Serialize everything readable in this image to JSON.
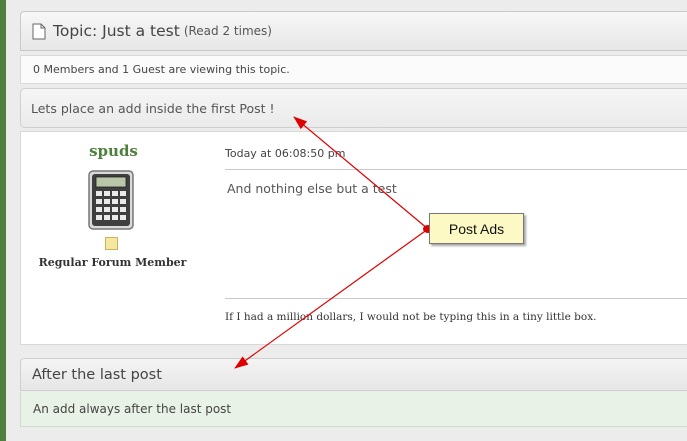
{
  "topic": {
    "title": "Topic: Just a test",
    "reads": "(Read 2 times)",
    "icon": "document-icon"
  },
  "viewers": "0 Members and 1 Guest are viewing this topic.",
  "ad_banner_text": "Lets place an add inside the first Post !",
  "post": {
    "author": "spuds",
    "avatar_icon": "calculator-icon",
    "rank_icon": "rank-star-icon",
    "rank_title": "Regular Forum Member",
    "date": "Today at 06:08:50 pm",
    "body": "And nothing else but a test",
    "signature": "If I had a million dollars, I would not be typing this in a tiny little box."
  },
  "after_last_post": {
    "title": "After the last post",
    "body": "An add always after the last post"
  },
  "annotation": {
    "label": "Post Ads",
    "arrow_color": "#e00000"
  },
  "colors": {
    "accent_green": "#4f7f3c",
    "ad_footer_bg": "#e9f2e6",
    "callout_bg": "#fdf9c4"
  }
}
